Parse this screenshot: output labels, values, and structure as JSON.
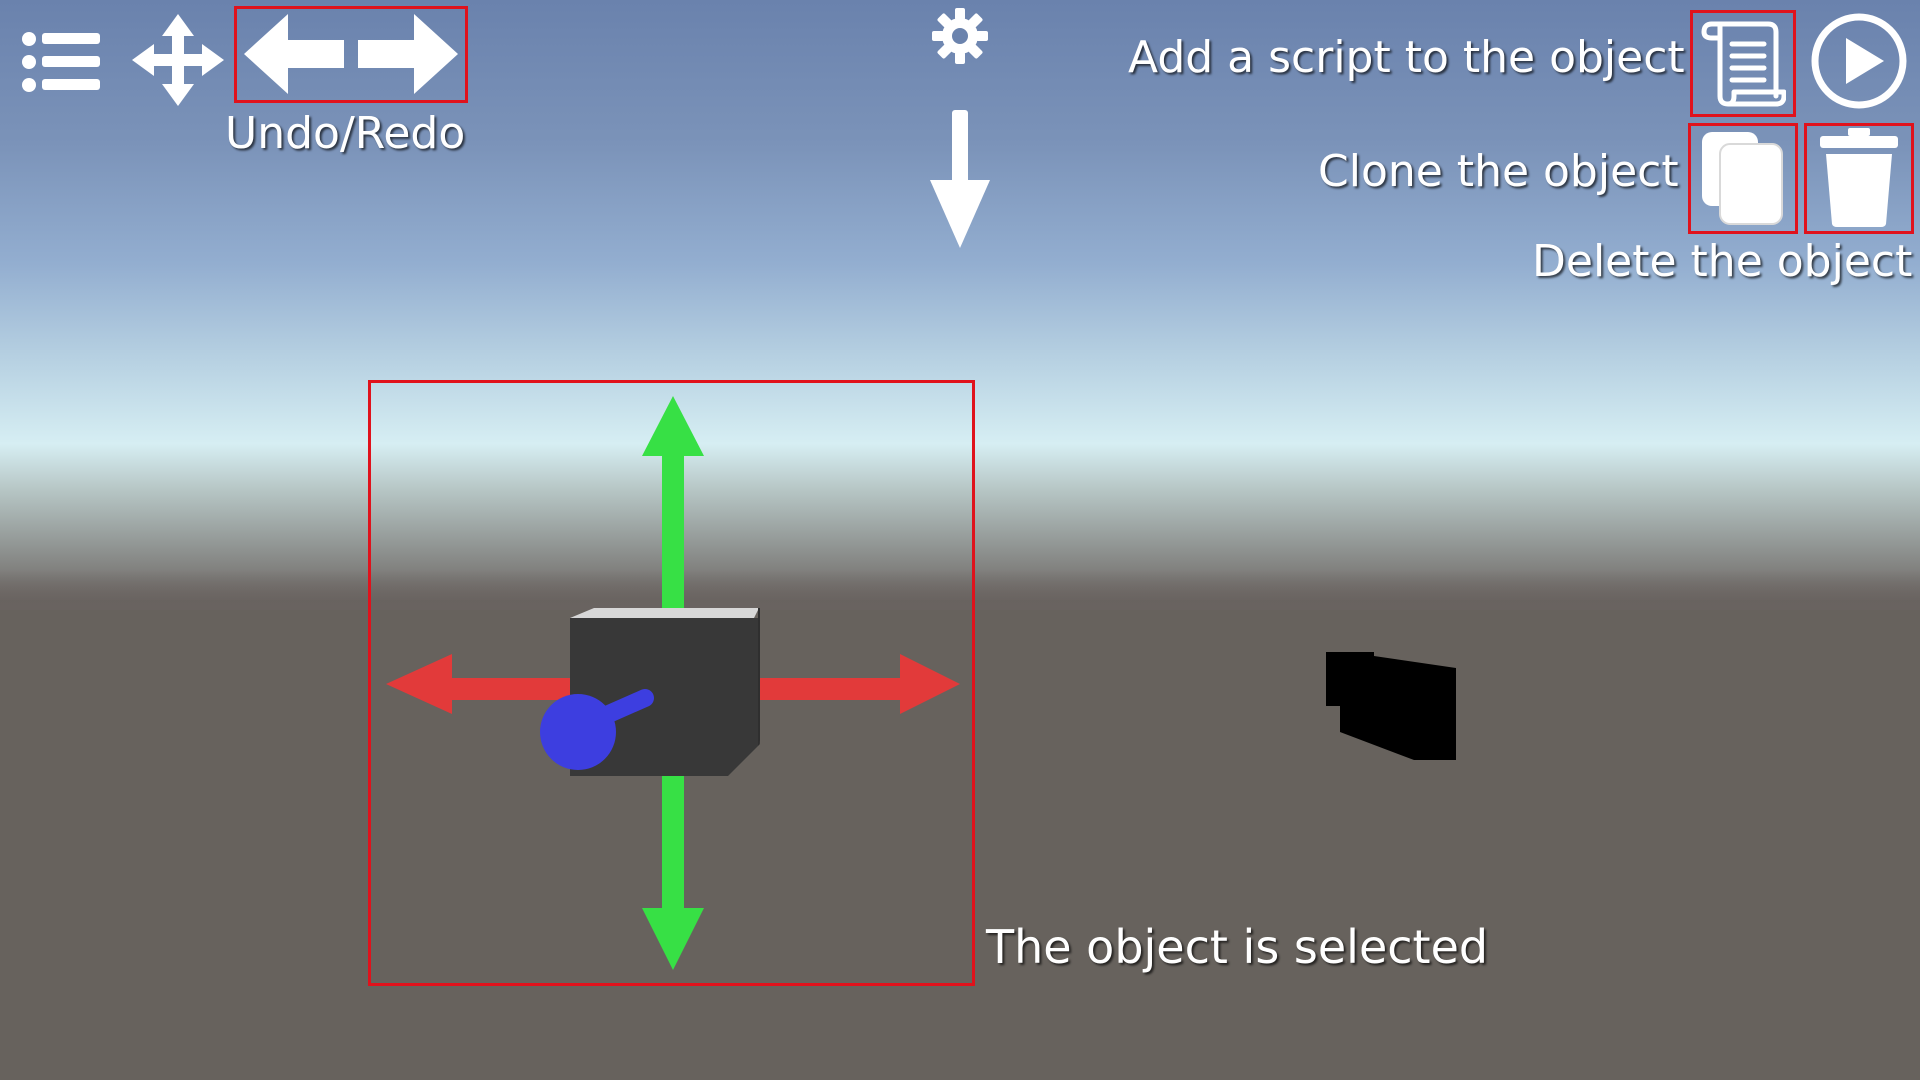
{
  "toolbar": {
    "menu_icon": "list-menu-icon",
    "move_icon": "move-arrows-icon",
    "undo_icon": "arrow-left-icon",
    "redo_icon": "arrow-right-icon",
    "undo_redo_label": "Undo/Redo",
    "settings_icon": "gear-icon",
    "down_arrow_icon": "arrow-down-icon",
    "play_icon": "play-icon"
  },
  "object_actions": {
    "add_script_label": "Add a script to the object",
    "add_script_icon": "script-scroll-icon",
    "clone_label": "Clone the object",
    "clone_icon": "copy-icon",
    "delete_label": "Delete the object",
    "delete_icon": "trash-icon"
  },
  "scene": {
    "selected_label": "The object is selected"
  },
  "colors": {
    "highlight": "#e0121c",
    "gizmo_x": "#e23a3a",
    "gizmo_y": "#37e045",
    "gizmo_z": "#3d3ee0",
    "cube_front": "#383838",
    "cube_top": "#d7d7d7",
    "icon_white": "#ffffff"
  }
}
